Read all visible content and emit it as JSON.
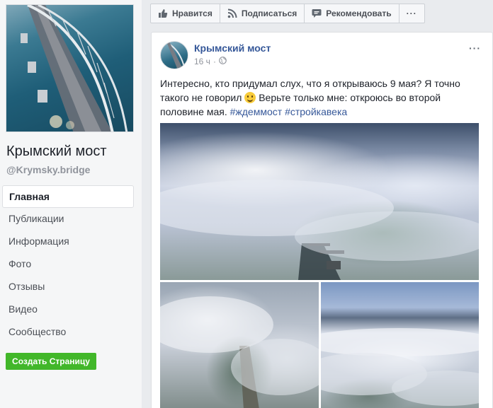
{
  "page": {
    "name": "Крымский мост",
    "handle": "@Krymsky.bridge"
  },
  "nav": {
    "items": [
      {
        "label": "Главная",
        "active": true
      },
      {
        "label": "Публикации"
      },
      {
        "label": "Информация"
      },
      {
        "label": "Фото"
      },
      {
        "label": "Отзывы"
      },
      {
        "label": "Видео"
      },
      {
        "label": "Сообщество"
      }
    ],
    "create_page_label": "Создать Страницу"
  },
  "actionbar": {
    "like_label": "Нравится",
    "follow_label": "Подписаться",
    "recommend_label": "Рекомендовать",
    "more_label": "···"
  },
  "post": {
    "author": "Крымский мост",
    "time": "16 ч",
    "separator": "·",
    "more_label": "···",
    "text_part1": "Интересно, кто придумал слух, что я открываюсь 9 мая? Я точно такого не говорил ",
    "text_part2": " Верьте только мне: откроюсь во второй половине мая. ",
    "hashtag1": "#ждеммост",
    "hashtag2": "#стройкавека"
  },
  "colors": {
    "link": "#365899",
    "create_button": "#42b72a",
    "background": "#e9ebee"
  },
  "icons": [
    "thumbs-up-icon",
    "rss-icon",
    "chat-bubble-icon",
    "globe-icon",
    "smiley-icon",
    "more-dots-icon"
  ]
}
